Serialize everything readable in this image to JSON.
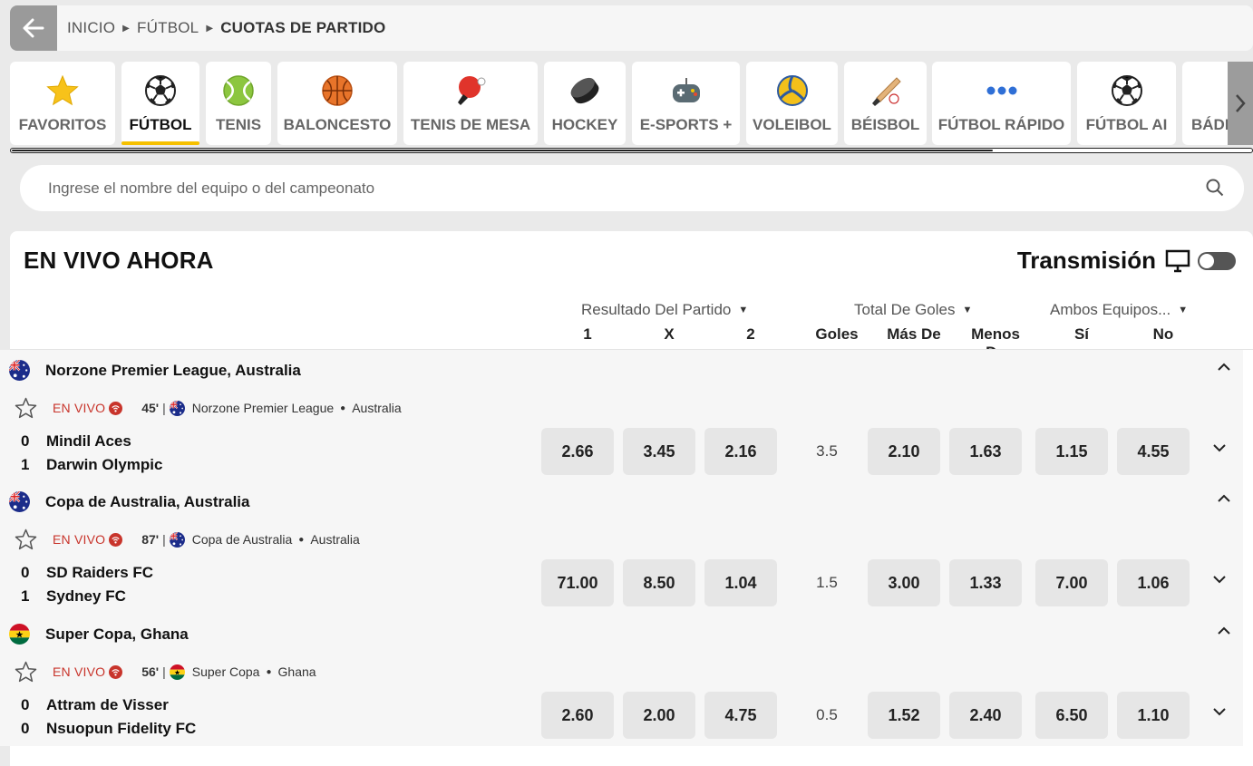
{
  "breadcrumb": {
    "home": "INICIO",
    "section": "FÚTBOL",
    "current": "CUOTAS DE PARTIDO"
  },
  "tabs": [
    {
      "label": "FAVORITOS",
      "icon": "star-icon"
    },
    {
      "label": "FÚTBOL",
      "icon": "soccer-ball-icon",
      "active": true
    },
    {
      "label": "TENIS",
      "icon": "tennis-ball-icon"
    },
    {
      "label": "BALONCESTO",
      "icon": "basketball-icon"
    },
    {
      "label": "TENIS DE MESA",
      "icon": "ping-pong-icon"
    },
    {
      "label": "HOCKEY",
      "icon": "hockey-puck-icon"
    },
    {
      "label": "E-SPORTS +",
      "icon": "gamepad-icon"
    },
    {
      "label": "VOLEIBOL",
      "icon": "volleyball-icon"
    },
    {
      "label": "BÉISBOL",
      "icon": "baseball-bat-icon"
    },
    {
      "label": "FÚTBOL RÁPIDO",
      "icon": "dots-icon"
    },
    {
      "label": "FÚTBOL AI",
      "icon": "soccer-ball-icon"
    },
    {
      "label": "BÁDMINT",
      "icon": "shuttlecock-icon"
    }
  ],
  "search": {
    "placeholder": "Ingrese el nombre del equipo o del campeonato"
  },
  "live": {
    "title": "EN VIVO AHORA",
    "stream_label": "Transmisión",
    "markets": {
      "result": "Resultado Del Partido",
      "total": "Total De Goles",
      "both": "Ambos Equipos..."
    },
    "columns": [
      "1",
      "X",
      "2",
      "Goles",
      "Más De",
      "Menos De",
      "Sí",
      "No"
    ]
  },
  "leagues": [
    {
      "name": "Norzone Premier League, Australia",
      "flag": "australia",
      "live_label": "EN VIVO",
      "minute": "45'",
      "competition": "Norzone Premier League",
      "country": "Australia",
      "home": {
        "score": "0",
        "name": "Mindil Aces"
      },
      "away": {
        "score": "1",
        "name": "Darwin Olympic"
      },
      "odds": [
        "2.66",
        "3.45",
        "2.16"
      ],
      "goals": "3.5",
      "totals": [
        "2.10",
        "1.63"
      ],
      "btts": [
        "1.15",
        "4.55"
      ]
    },
    {
      "name": "Copa de Australia, Australia",
      "flag": "australia",
      "live_label": "EN VIVO",
      "minute": "87'",
      "competition": "Copa de Australia",
      "country": "Australia",
      "home": {
        "score": "0",
        "name": "SD Raiders FC"
      },
      "away": {
        "score": "1",
        "name": "Sydney FC"
      },
      "odds": [
        "71.00",
        "8.50",
        "1.04"
      ],
      "goals": "1.5",
      "totals": [
        "3.00",
        "1.33"
      ],
      "btts": [
        "7.00",
        "1.06"
      ]
    },
    {
      "name": "Super Copa, Ghana",
      "flag": "ghana",
      "live_label": "EN VIVO",
      "minute": "56'",
      "competition": "Super Copa",
      "country": "Ghana",
      "home": {
        "score": "0",
        "name": "Attram de Visser"
      },
      "away": {
        "score": "0",
        "name": "Nsuopun Fidelity FC"
      },
      "odds": [
        "2.60",
        "2.00",
        "4.75"
      ],
      "goals": "0.5",
      "totals": [
        "1.52",
        "2.40"
      ],
      "btts": [
        "6.50",
        "1.10"
      ]
    }
  ],
  "colors": {
    "accent": "#f5c000",
    "live": "#c8342b",
    "odd_bg": "#e6e6e6"
  }
}
